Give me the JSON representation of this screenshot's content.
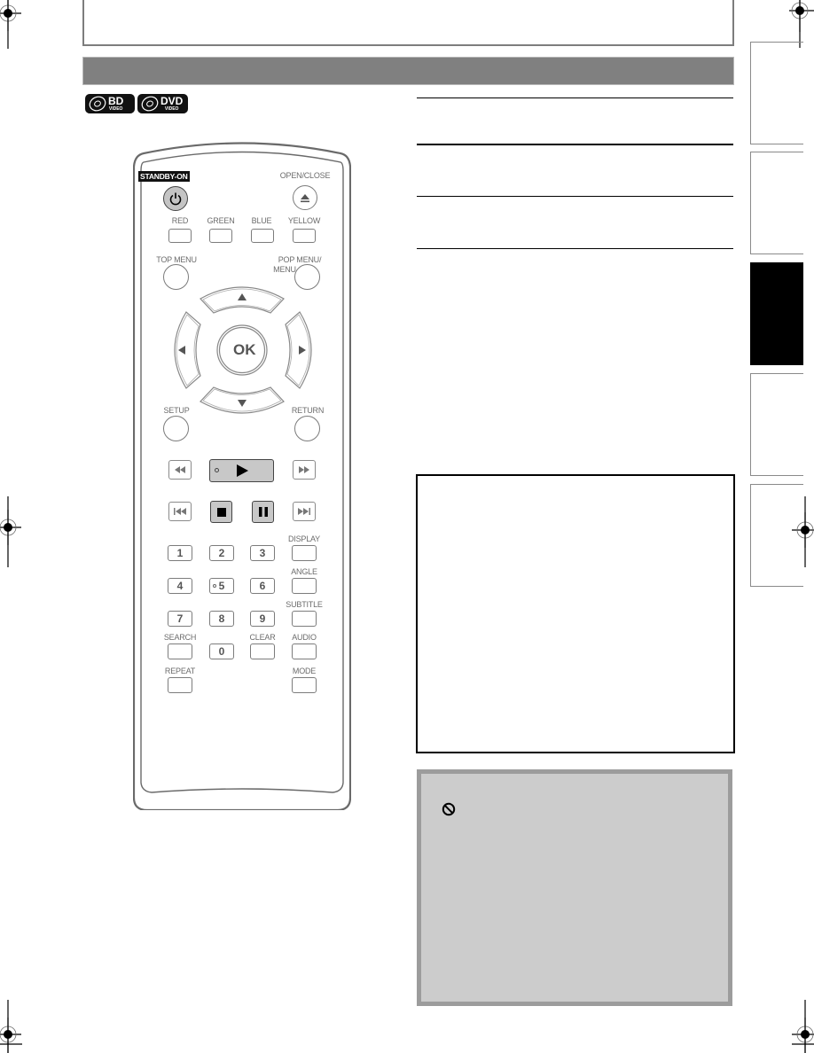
{
  "header": {
    "title_bar_text": ""
  },
  "disc_badges": [
    {
      "label": "BD",
      "sublabel": "VIDEO"
    },
    {
      "label": "DVD",
      "sublabel": "VIDEO"
    }
  ],
  "remote": {
    "standby_label": "STANDBY-ON",
    "open_close_label": "OPEN/CLOSE",
    "color_buttons": [
      "RED",
      "GREEN",
      "BLUE",
      "YELLOW"
    ],
    "top_menu_label": "TOP MENU",
    "pop_menu_label_1": "POP MENU/",
    "pop_menu_label_2": "MENU",
    "ok_label": "OK",
    "setup_label": "SETUP",
    "return_label": "RETURN",
    "display_label": "DISPLAY",
    "angle_label": "ANGLE",
    "subtitle_label": "SUBTITLE",
    "search_label": "SEARCH",
    "clear_label": "CLEAR",
    "audio_label": "AUDIO",
    "repeat_label": "REPEAT",
    "mode_label": "MODE",
    "numbers": [
      "1",
      "2",
      "3",
      "4",
      "5",
      "6",
      "7",
      "8",
      "9",
      "0"
    ]
  },
  "side_tabs": [
    {
      "label": "",
      "active": false
    },
    {
      "label": "",
      "active": false
    },
    {
      "label": "",
      "active": true
    },
    {
      "label": "",
      "active": false
    },
    {
      "label": "",
      "active": false
    }
  ],
  "note_box": {
    "text": ""
  },
  "tip_box": {
    "icon": "prohibit-icon",
    "text": ""
  },
  "colors": {
    "title_bar": "#808080",
    "tip_box_bg": "#cccccc",
    "tip_box_border": "#9c9c9c",
    "active_tab": "#000000"
  }
}
